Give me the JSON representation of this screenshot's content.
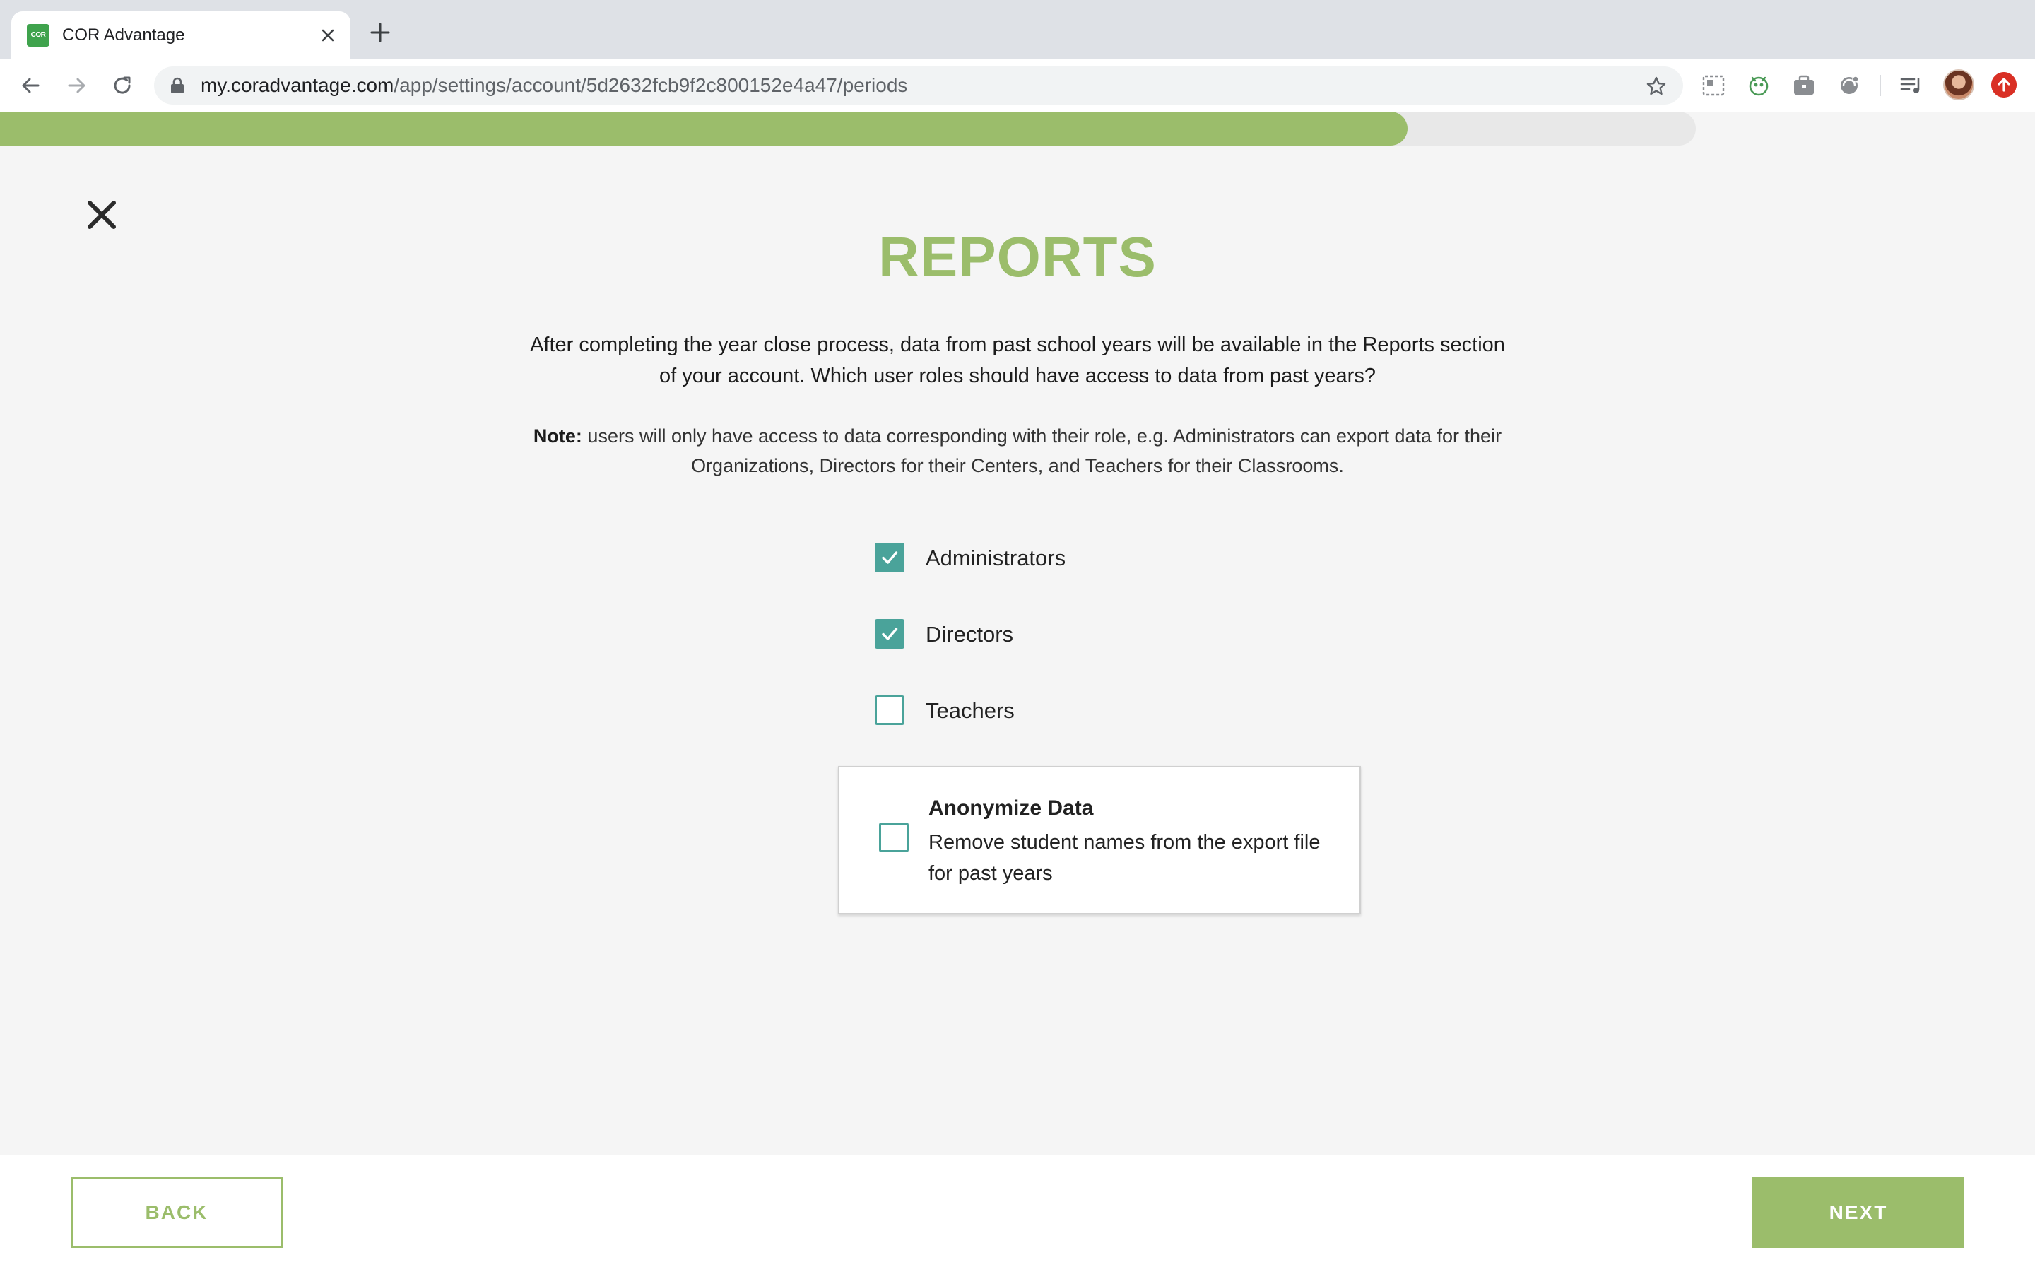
{
  "browser": {
    "tab": {
      "title": "COR Advantage",
      "favicon_text": "COR"
    },
    "address": {
      "host": "my.coradvantage.com",
      "path": "/app/settings/account/5d2632fcb9f2c800152e4a47/periods"
    },
    "icons": [
      "back-icon",
      "forward-icon",
      "reload-icon",
      "lock-icon",
      "bookmark-star-icon",
      "extension-icon",
      "media-icon",
      "profile-avatar",
      "update-icon"
    ]
  },
  "progress": {
    "fraction": 0.83,
    "color": "#9bbd6b"
  },
  "page": {
    "title": "REPORTS",
    "intro": "After completing the year close process, data from past school years will be available in the Reports section of your account. Which user roles should have access to data from past years?",
    "note_label": "Note:",
    "note_text": " users will only have access to data corresponding with their role, e.g. Administrators can export data for their Organizations, Directors for their Centers, and Teachers for their Classrooms.",
    "roles": [
      {
        "label": "Administrators",
        "checked": true
      },
      {
        "label": "Directors",
        "checked": true
      },
      {
        "label": "Teachers",
        "checked": false
      }
    ],
    "anonymize": {
      "title": "Anonymize Data",
      "description": "Remove student names from the export file for past years",
      "checked": false
    }
  },
  "footer": {
    "back_label": "BACK",
    "next_label": "NEXT"
  },
  "colors": {
    "accent": "#9bbd6b",
    "checkbox": "#4aa39a"
  }
}
